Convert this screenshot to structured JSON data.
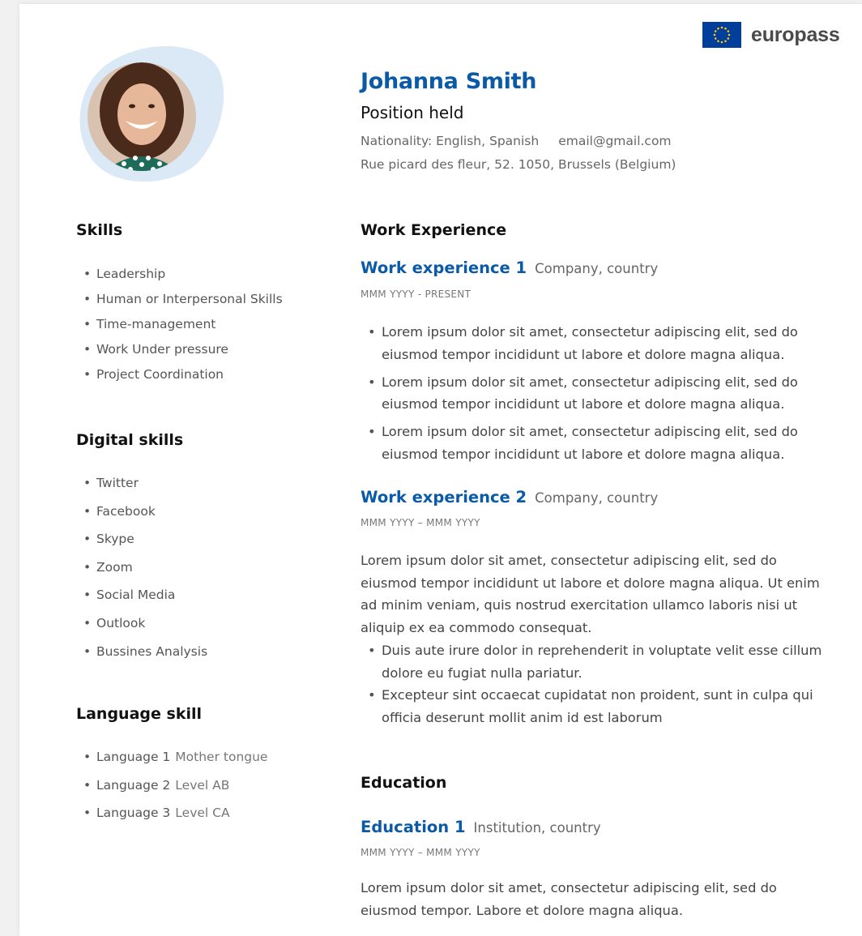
{
  "brand": {
    "name": "europass"
  },
  "colors": {
    "accent": "#0a5aa8",
    "flag": "#003e9b",
    "star": "#ffcc00",
    "blob": "#dbe8f5"
  },
  "header": {
    "name": "Johanna Smith",
    "position": "Position held",
    "nationality": "Nationality: English, Spanish",
    "email": "email@gmail.com",
    "address": "Rue picard des fleur, 52. 1050, Brussels (Belgium)"
  },
  "skills": {
    "title": "Skills",
    "items": [
      "Leadership",
      "Human or Interpersonal Skills",
      "Time-management",
      "Work Under pressure",
      "Project Coordination"
    ]
  },
  "digital_skills": {
    "title": "Digital skills",
    "items": [
      "Twitter",
      "Facebook",
      "Skype",
      "Zoom",
      "Social Media",
      "Outlook",
      "Bussines Analysis"
    ]
  },
  "language_skill": {
    "title": "Language skill",
    "items": [
      {
        "name": "Language 1",
        "level": "Mother tongue"
      },
      {
        "name": "Language 2",
        "level": "Level AB"
      },
      {
        "name": "Language 3",
        "level": "Level CA"
      }
    ]
  },
  "work_experience": {
    "title": "Work Experience",
    "jobs": [
      {
        "title": "Work experience 1",
        "company": "Company, country",
        "dates": "MMM YYYY - PRESENT",
        "bullets": [
          "Lorem ipsum dolor sit amet, consectetur adipiscing elit, sed do eiusmod tempor incididunt ut labore et dolore magna aliqua.",
          "Lorem ipsum dolor sit amet, consectetur adipiscing elit, sed do eiusmod tempor incididunt ut labore et dolore magna aliqua.",
          "Lorem ipsum dolor sit amet, consectetur adipiscing elit, sed do eiusmod tempor incididunt ut labore et dolore magna aliqua."
        ]
      },
      {
        "title": "Work experience 2",
        "company": "Company, country",
        "dates": "MMM YYYY – MMM YYYY",
        "description": "Lorem ipsum dolor sit amet, consectetur adipiscing elit, sed do eiusmod tempor incididunt ut labore et dolore magna aliqua. Ut enim ad minim veniam, quis nostrud exercitation ullamco laboris nisi ut aliquip ex ea commodo consequat.",
        "bullets": [
          "Duis aute irure dolor in reprehenderit in voluptate velit esse cillum dolore eu fugiat nulla pariatur.",
          "Excepteur sint occaecat cupidatat non proident, sunt in culpa qui officia deserunt mollit anim id est laborum"
        ]
      }
    ]
  },
  "education": {
    "title": "Education",
    "entries": [
      {
        "title": "Education 1",
        "institution": "Institution, country",
        "dates": "MMM YYYY – MMM YYYY",
        "description": "Lorem ipsum dolor sit amet, consectetur adipiscing elit, sed do eiusmod tempor. Labore et dolore magna aliqua."
      }
    ]
  }
}
